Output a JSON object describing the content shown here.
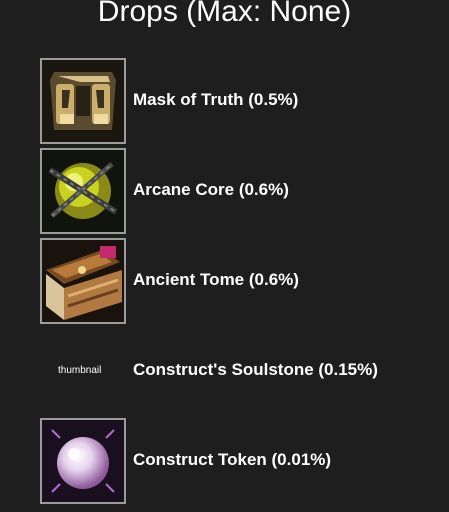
{
  "header": {
    "title": "Drops (Max: None)"
  },
  "drops": [
    {
      "label": "Mask of Truth (0.5%)",
      "icon": "mask-of-truth-icon"
    },
    {
      "label": "Arcane Core (0.6%)",
      "icon": "arcane-core-icon"
    },
    {
      "label": "Ancient Tome (0.6%)",
      "icon": "ancient-tome-icon"
    },
    {
      "label": "Construct's Soulstone (0.15%)",
      "icon": "",
      "thumb_alt": "thumbnail"
    },
    {
      "label": "Construct Token (0.01%)",
      "icon": "construct-token-icon"
    }
  ],
  "colors": {
    "background": "#1e1e1e",
    "text": "#ffffff",
    "frame": "#9b9b9b"
  }
}
